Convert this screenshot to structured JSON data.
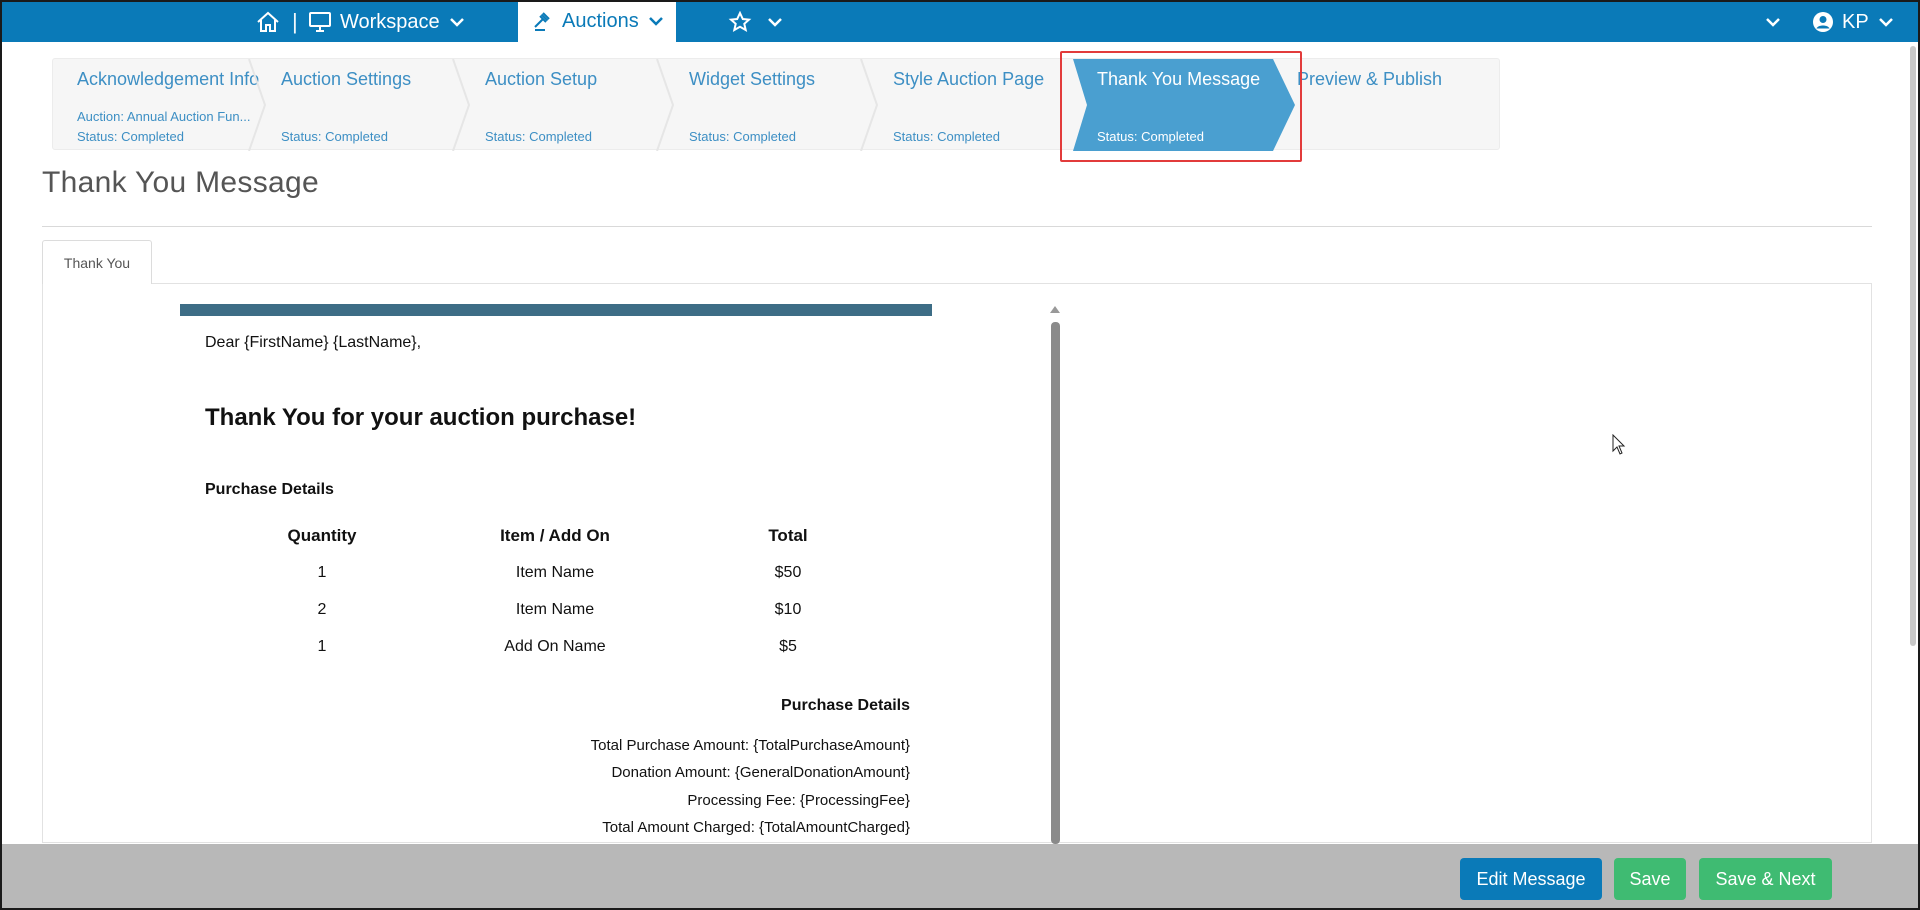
{
  "topnav": {
    "home_separator": "|",
    "workspace_label": "Workspace",
    "auctions_label": "Auctions",
    "user_initials": "KP",
    "colors": {
      "bar": "#0a7ab8",
      "active_tab_bg": "#ffffff"
    }
  },
  "wizard": {
    "steps": [
      {
        "title": "Acknowledgement Info",
        "subtitle": "Auction: Annual Auction Fun...",
        "status": "Status: Completed"
      },
      {
        "title": "Auction Settings",
        "status": "Status: Completed"
      },
      {
        "title": "Auction Setup",
        "status": "Status: Completed"
      },
      {
        "title": "Widget Settings",
        "status": "Status: Completed"
      },
      {
        "title": "Style Auction Page",
        "status": "Status: Completed"
      },
      {
        "title": "Thank You Message",
        "status": "Status: Completed",
        "active": true
      },
      {
        "title": "Preview & Publish"
      }
    ],
    "colors": {
      "active_bg": "#4a9fd0",
      "text": "#3d8fc4",
      "highlight_border": "#e23b3b"
    }
  },
  "page": {
    "title": "Thank You Message",
    "tabs": [
      {
        "label": "Thank You"
      }
    ]
  },
  "email": {
    "greeting": "Dear {FirstName} {LastName},",
    "headline": "Thank You for your auction purchase!",
    "purchase_details_label": "Purchase Details",
    "table": {
      "headers": [
        "Quantity",
        "Item / Add On",
        "Total"
      ],
      "rows": [
        [
          "1",
          "Item Name",
          "$50"
        ],
        [
          "2",
          "Item Name",
          "$10"
        ],
        [
          "1",
          "Add On Name",
          "$5"
        ]
      ]
    },
    "summary": {
      "title": "Purchase Details",
      "lines": [
        "Total Purchase Amount: {TotalPurchaseAmount}",
        "Donation Amount: {GeneralDonationAmount}",
        "Processing Fee: {ProcessingFee}",
        "Total Amount Charged: {TotalAmountCharged}"
      ]
    },
    "colors": {
      "top_bar": "#3d6d86"
    }
  },
  "actions": {
    "edit_message": "Edit Message",
    "save": "Save",
    "save_next": "Save & Next",
    "colors": {
      "primary": "#0a7ab8",
      "success": "#3fbb72",
      "bar": "#b8b8b8"
    }
  }
}
